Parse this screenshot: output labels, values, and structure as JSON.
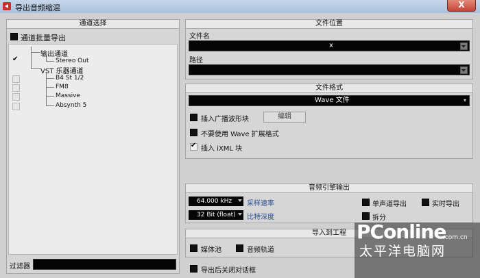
{
  "window": {
    "title": "导出音频缩混",
    "close_glyph": "X"
  },
  "channels": {
    "header": "通道选择",
    "batch_export_label": "通道批量导出",
    "batch_export_checked": false,
    "tree": {
      "output_group": "输出通道",
      "stereo_out": "Stereo Out",
      "stereo_out_checked": true,
      "vsti_group": "VST 乐器通道",
      "instruments": [
        {
          "label": "B4 St 1/2",
          "checked": false
        },
        {
          "label": "FM8",
          "checked": false
        },
        {
          "label": "Massive",
          "checked": false
        },
        {
          "label": "Absynth 5",
          "checked": false
        }
      ]
    },
    "filter_label": "过滤器",
    "filter_value": ""
  },
  "file_location": {
    "header": "文件位置",
    "name_label": "文件名",
    "name_value": "x",
    "path_label": "路径",
    "path_value": ""
  },
  "file_format": {
    "header": "文件格式",
    "format_value": "Wave 文件",
    "insert_broadcast_label": "插入广播波形块",
    "insert_broadcast_checked": false,
    "edit_button": "编辑",
    "no_wave_ext_label": "不要使用 Wave 扩展格式",
    "no_wave_ext_checked": false,
    "insert_ixml_label": "插入 iXML 块",
    "insert_ixml_checked": true
  },
  "audio_engine": {
    "header": "音频引擎输出",
    "sample_rate_value": "64.000 kHz",
    "sample_rate_label": "采样速率",
    "bit_depth_value": "32 Bit (float)",
    "bit_depth_label": "比特深度",
    "mono_export_label": "单声道导出",
    "mono_export_checked": false,
    "realtime_export_label": "实时导出",
    "realtime_export_checked": false,
    "split_label": "拆分",
    "split_checked": false
  },
  "import_project": {
    "header": "导入到工程",
    "pool_label": "媒体池",
    "pool_checked": false,
    "audio_track_label": "音频轨道",
    "audio_track_checked": false
  },
  "close_after_export_label": "导出后关闭对话框",
  "close_after_export_checked": false,
  "watermark": {
    "brand": "PConline",
    "domain": ".com.cn",
    "sub": "太平洋电脑网"
  },
  "colors": {
    "panel_bg": "#d6d6d6",
    "field_bg": "#050505",
    "accent_text": "#2a4f8c"
  }
}
